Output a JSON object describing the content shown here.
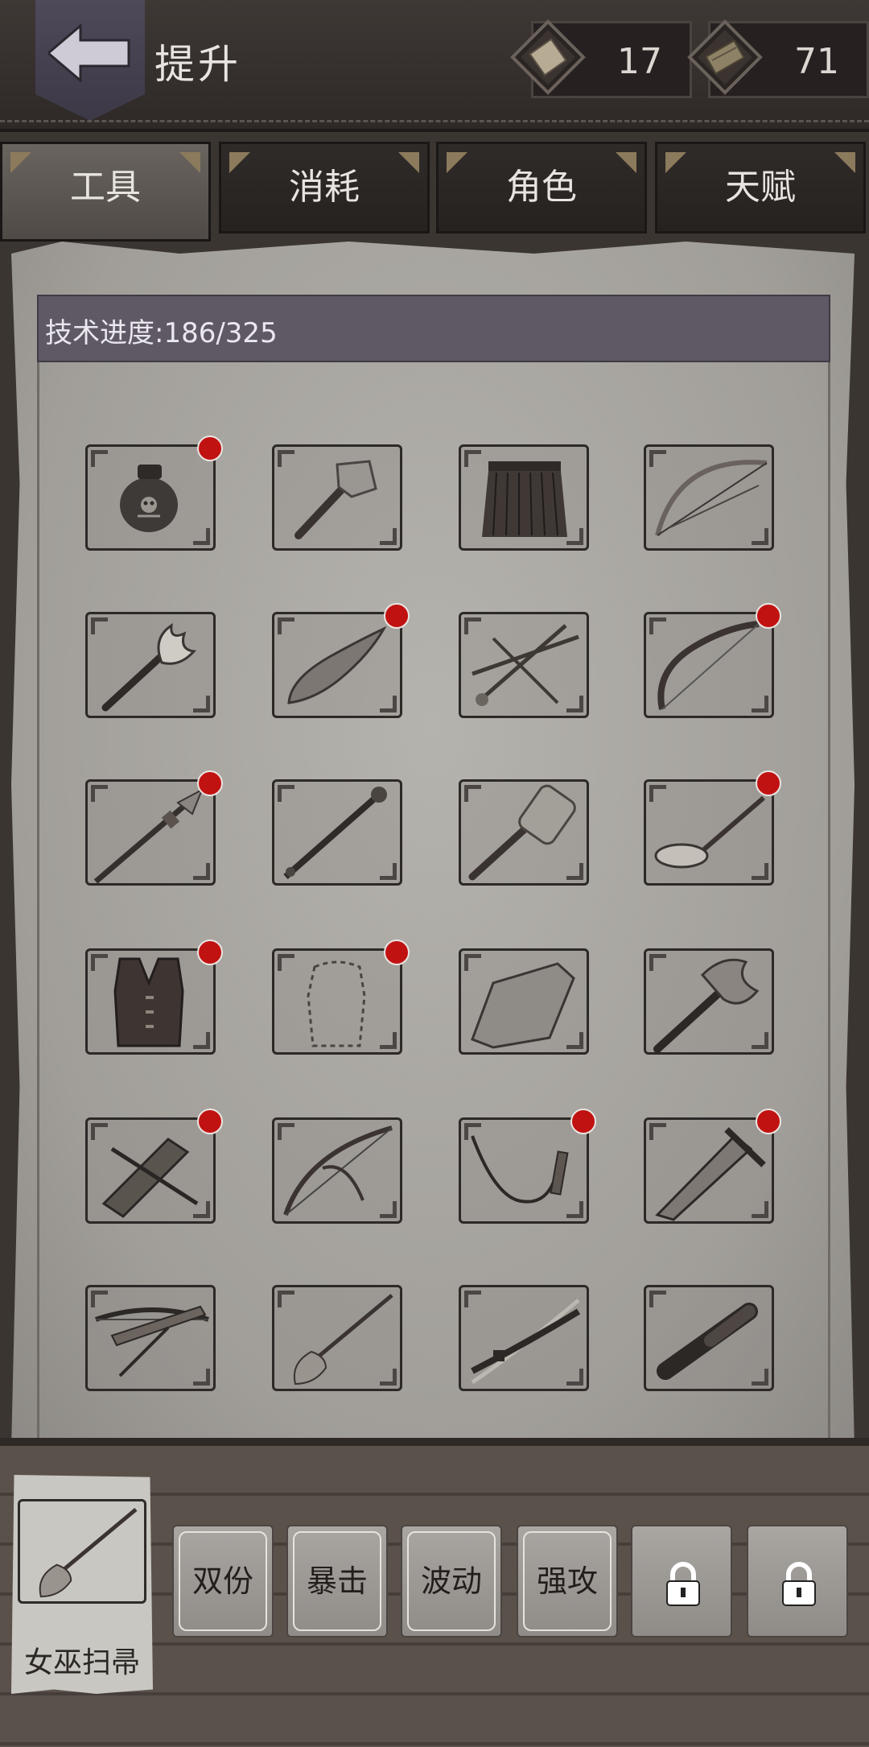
{
  "header": {
    "title": "提升",
    "currencies": [
      {
        "icon": "book-icon",
        "value": "17"
      },
      {
        "icon": "scroll-icon",
        "value": "71"
      }
    ]
  },
  "tabs": [
    {
      "label": "工具",
      "active": true
    },
    {
      "label": "消耗",
      "active": false
    },
    {
      "label": "角色",
      "active": false
    },
    {
      "label": "天赋",
      "active": false
    }
  ],
  "progress": {
    "label": "技术进度:186/325",
    "current": 186,
    "total": 325
  },
  "items": [
    {
      "icon": "poison-pot-icon",
      "new": true
    },
    {
      "icon": "stone-axe-icon",
      "new": false
    },
    {
      "icon": "grass-skirt-icon",
      "new": false
    },
    {
      "icon": "bow-icon",
      "new": false
    },
    {
      "icon": "torch-icon",
      "new": false
    },
    {
      "icon": "stone-knife-icon",
      "new": true
    },
    {
      "icon": "arrows-icon",
      "new": false
    },
    {
      "icon": "recurve-bow-icon",
      "new": true
    },
    {
      "icon": "spear-icon",
      "new": true
    },
    {
      "icon": "mace-icon",
      "new": false
    },
    {
      "icon": "stone-hammer-icon",
      "new": false
    },
    {
      "icon": "frying-pan-icon",
      "new": true
    },
    {
      "icon": "leather-vest-icon",
      "new": true
    },
    {
      "icon": "shirt-outline-icon",
      "new": true
    },
    {
      "icon": "stone-block-icon",
      "new": false
    },
    {
      "icon": "iron-axe-icon",
      "new": false
    },
    {
      "icon": "crossbow-stock-icon",
      "new": true
    },
    {
      "icon": "compound-bow-icon",
      "new": false
    },
    {
      "icon": "whip-icon",
      "new": true
    },
    {
      "icon": "broad-sword-icon",
      "new": true
    },
    {
      "icon": "crossbow-icon",
      "new": false
    },
    {
      "icon": "broom-icon",
      "new": false
    },
    {
      "icon": "katana-icon",
      "new": false
    },
    {
      "icon": "baton-icon",
      "new": false
    }
  ],
  "equipped": {
    "name": "女巫扫帚",
    "icon": "broom-icon"
  },
  "skills": [
    {
      "label": "双份",
      "locked": false
    },
    {
      "label": "暴击",
      "locked": false
    },
    {
      "label": "波动",
      "locked": false
    },
    {
      "label": "强攻",
      "locked": false
    },
    {
      "label": "",
      "locked": true
    },
    {
      "label": "",
      "locked": true
    }
  ]
}
